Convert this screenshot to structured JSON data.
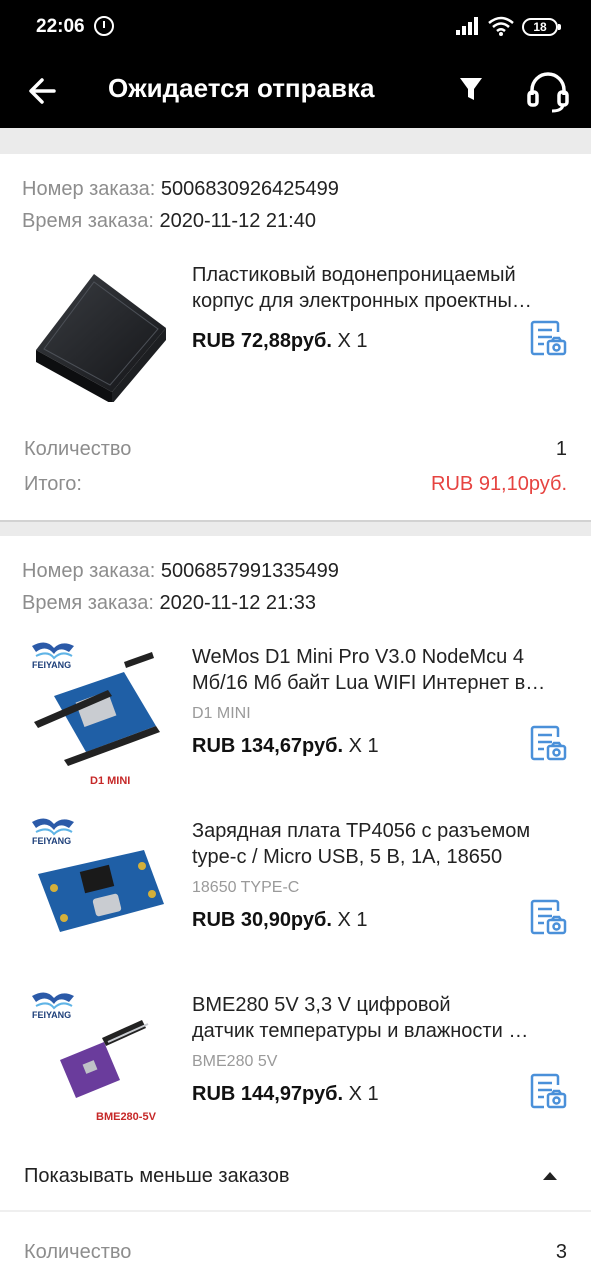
{
  "status": {
    "time": "22:06",
    "battery": "18"
  },
  "header": {
    "title": "Ожидается отправка"
  },
  "labels": {
    "order_number": "Номер заказа:",
    "order_time": "Время заказа:",
    "quantity": "Количество",
    "total": "Итого:",
    "show_less": "Показывать меньше заказов"
  },
  "orders": [
    {
      "number": "5006830926425499",
      "time": "2020-11-12 21:40",
      "items": [
        {
          "title_line1": "Пластиковый водонепроницаемый",
          "title_line2": "корпус для электронных проектны…",
          "price": "RUB 72,88руб.",
          "qty": "X 1"
        }
      ],
      "quantity": "1",
      "total": "RUB 91,10руб."
    },
    {
      "number": "5006857991335499",
      "time": "2020-11-12 21:33",
      "items": [
        {
          "title_line1": "WeMos D1 Mini Pro V3.0 NodeMcu 4",
          "title_line2": "Мб/16 Мб байт Lua WIFI Интернет в…",
          "variant": "D1 MINI",
          "price": "RUB 134,67руб.",
          "qty": "X 1",
          "brand": "FEIYANG",
          "image_caption": "D1 MINI"
        },
        {
          "title_line1": "Зарядная плата TP4056 с разъемом",
          "title_line2": "type-c / Micro USB, 5 В, 1А, 18650",
          "variant": "18650 TYPE-C",
          "price": "RUB 30,90руб.",
          "qty": "X 1",
          "brand": "FEIYANG"
        },
        {
          "title_line1": "BME280 5V 3,3 V цифровой",
          "title_line2": "датчик температуры и влажности …",
          "variant": "BME280 5V",
          "price": "RUB 144,97руб.",
          "qty": "X 1",
          "brand": "FEIYANG",
          "image_caption": "BME280-5V"
        }
      ],
      "quantity": "3"
    }
  ],
  "colors": {
    "accent_red": "#e64340",
    "icon_blue": "#4a90d9"
  }
}
